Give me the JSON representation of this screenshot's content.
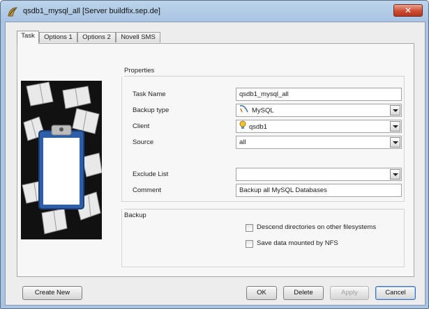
{
  "window": {
    "title": "qsdb1_mysql_all [Server buildfix.sep.de]",
    "close_glyph": "✕"
  },
  "tabs": [
    {
      "label": "Task",
      "active": true
    },
    {
      "label": "Options 1",
      "active": false
    },
    {
      "label": "Options 2",
      "active": false
    },
    {
      "label": "Novell SMS",
      "active": false
    }
  ],
  "properties": {
    "section_label": "Properties",
    "task_name": {
      "label": "Task Name",
      "value": "qsdb1_mysql_all"
    },
    "backup_type": {
      "label": "Backup type",
      "value": "MySQL",
      "icon": "mysql-icon"
    },
    "client": {
      "label": "Client",
      "value": "qsdb1",
      "icon": "client-bulb-icon"
    },
    "source": {
      "label": "Source",
      "value": "all"
    },
    "exclude_list": {
      "label": "Exclude List",
      "value": ""
    },
    "comment": {
      "label": "Comment",
      "value": "Backup all MySQL Databases"
    }
  },
  "backup": {
    "section_label": "Backup",
    "descend_label": "Descend directories on other filesystems",
    "descend_checked": false,
    "nfs_label": "Save data mounted by NFS",
    "nfs_checked": false
  },
  "buttons": {
    "create_new": "Create New",
    "ok": "OK",
    "delete": "Delete",
    "apply": "Apply",
    "cancel": "Cancel"
  },
  "colors": {
    "title_bar": "#a9c4e2",
    "close_button": "#cd4d32",
    "default_button_border": "#3b73b8"
  }
}
